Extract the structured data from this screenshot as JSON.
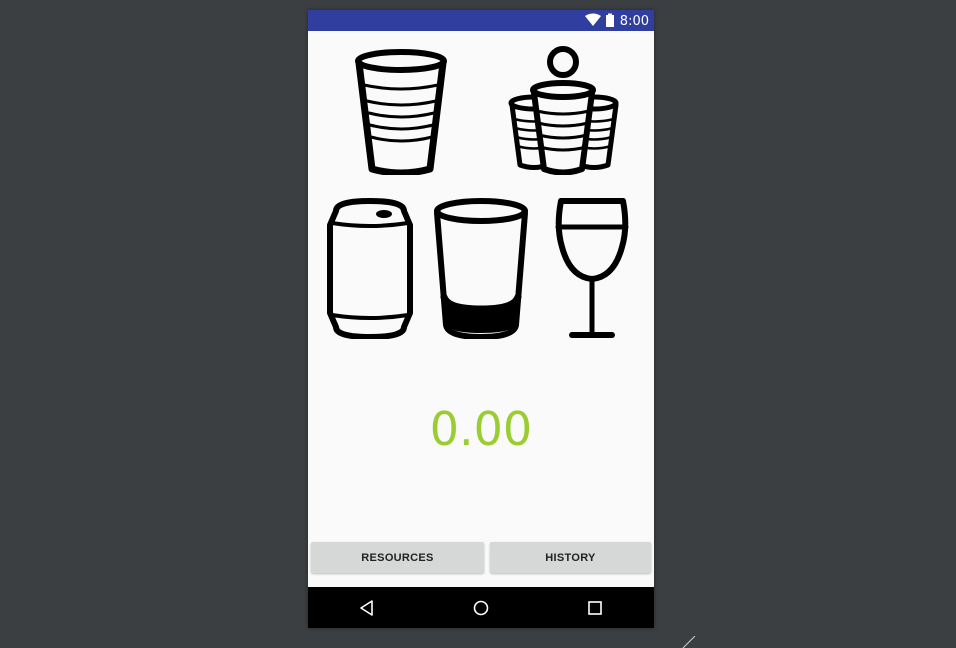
{
  "status_bar": {
    "time": "8:00",
    "icons": [
      "wifi-icon",
      "battery-icon"
    ],
    "color": "#303f9f"
  },
  "drinks": [
    {
      "name": "solo-cup",
      "icon": "solo-cup-icon"
    },
    {
      "name": "beer-pong",
      "icon": "beer-pong-icon"
    },
    {
      "name": "beer-can",
      "icon": "beer-can-icon"
    },
    {
      "name": "shot-glass",
      "icon": "shot-glass-icon"
    },
    {
      "name": "wine-glass",
      "icon": "wine-glass-icon"
    }
  ],
  "bac": {
    "value": "0.00",
    "color": "#9acd32"
  },
  "buttons": {
    "resources_label": "RESOURCES",
    "history_label": "HISTORY"
  },
  "nav_bar": {
    "icons": [
      "back-icon",
      "home-icon",
      "recents-icon"
    ]
  }
}
